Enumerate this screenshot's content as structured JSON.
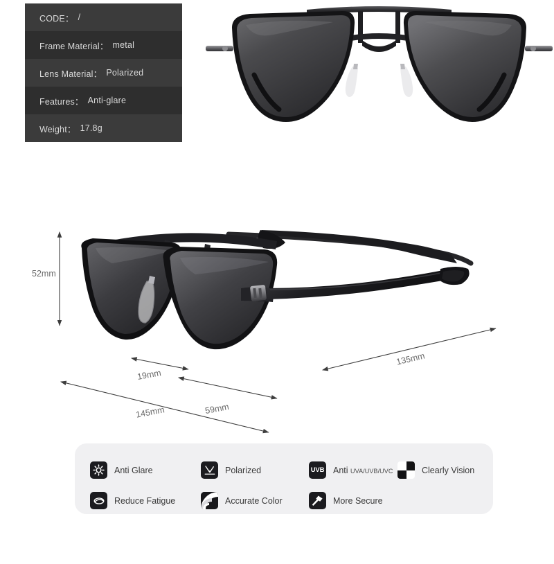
{
  "spec_table": {
    "rows": [
      {
        "label": "CODE：",
        "value": "/"
      },
      {
        "label": "Frame Material：",
        "value": "metal"
      },
      {
        "label": "Lens Material：",
        "value": "Polarized"
      },
      {
        "label": "Features：",
        "value": "Anti-glare"
      },
      {
        "label": "Weight：",
        "value": "17.8g"
      }
    ]
  },
  "dimensions": {
    "lens_height": "52mm",
    "bridge": "19mm",
    "lens_width": "59mm",
    "frame_width": "145mm",
    "temple_length": "135mm"
  },
  "features": [
    {
      "icon": "anti-glare-icon",
      "label": "Anti Glare",
      "sub": ""
    },
    {
      "icon": "reduce-fatigue-icon",
      "label": "Reduce Fatigue",
      "sub": ""
    },
    {
      "icon": "polarized-icon",
      "label": "Polarized",
      "sub": ""
    },
    {
      "icon": "accurate-color-icon",
      "label": "Accurate Color",
      "sub": ""
    },
    {
      "icon": "uvb-icon",
      "label": "Anti",
      "sub": "UVA/UVB/UVC",
      "badge": "UVB"
    },
    {
      "icon": "more-secure-icon",
      "label": "More Secure",
      "sub": ""
    },
    {
      "icon": "clearly-vision-icon",
      "label": "Clearly Vision",
      "sub": ""
    }
  ],
  "colors": {
    "table_row_light": "#3b3b3b",
    "table_row_dark": "#2e2e2e",
    "table_text": "#d9d9d9",
    "card_bg": "#f0f0f2",
    "icon_bg": "#1b1b1f",
    "dim_text": "#6b6b6b"
  }
}
